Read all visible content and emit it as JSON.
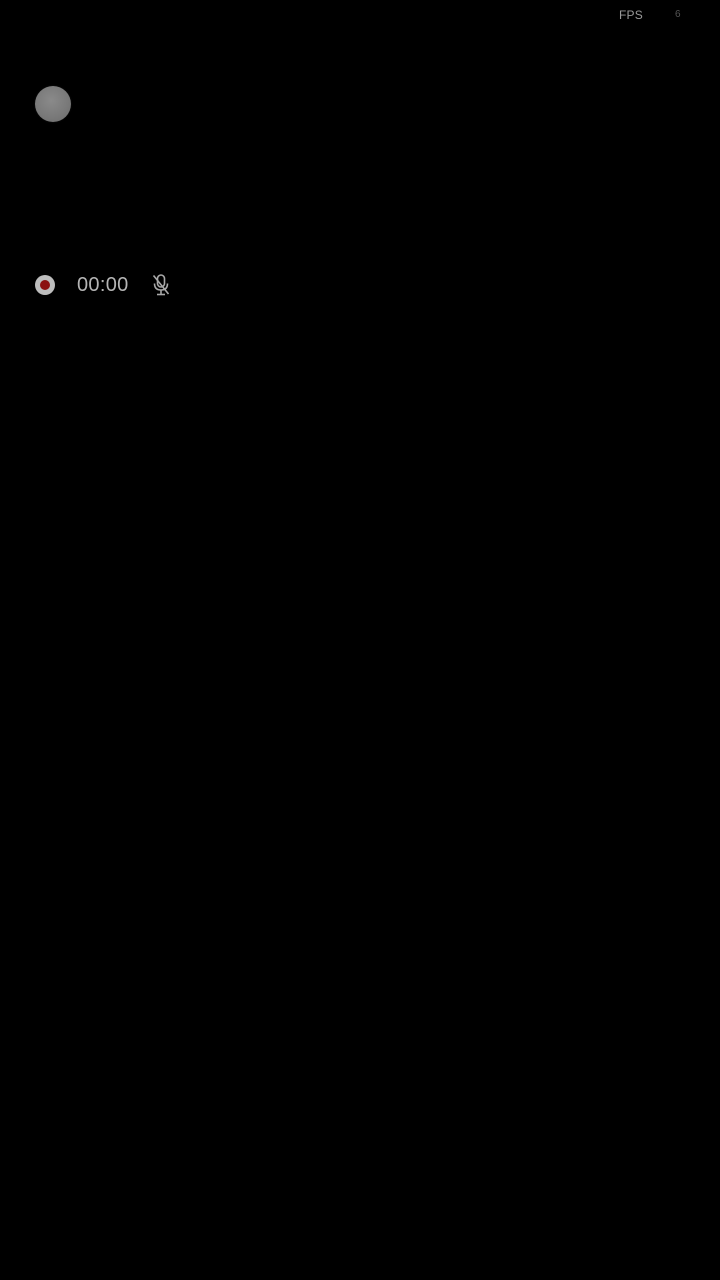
{
  "fps_overlay": {
    "label": "FPS",
    "value": "6"
  },
  "floating_bubble": {
    "icon": "floating-bubble-icon"
  },
  "recorder": {
    "timer": "00:00",
    "record_icon": "record-icon",
    "mic_icon": "mic-muted-icon"
  },
  "colors": {
    "background": "#000000",
    "record_dot": "#8b1010",
    "text": "#b4b4b4"
  }
}
